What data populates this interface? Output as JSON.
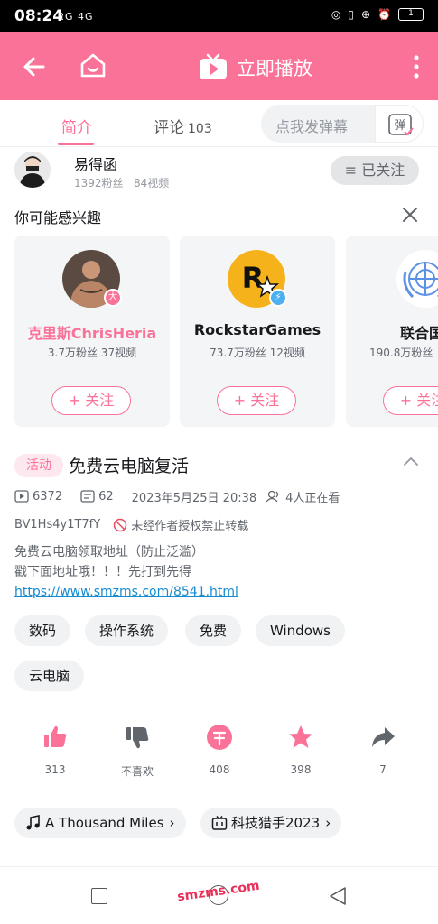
{
  "status_bar": {
    "time": "08:24",
    "signal": "2G 4G",
    "battery": "1"
  },
  "header": {
    "title": "立即播放",
    "accent": "#fb7299"
  },
  "tabs": {
    "intro": "简介",
    "comment": "评论",
    "comment_count": "103",
    "danmaku_placeholder": "点我发弹幕",
    "danmaku_button": "弹"
  },
  "uploader": {
    "name": "易得函",
    "fans": "1392粉丝",
    "videos": "84视频",
    "follow_state": "≡ 已关注"
  },
  "recommend": {
    "title": "你可能感兴趣",
    "cards": [
      {
        "name": "克里斯ChrisHeria",
        "stats": "3.7万粉丝 37视频",
        "follow": "+ 关注",
        "name_color": "#fb7299",
        "badge": "大"
      },
      {
        "name": "RockstarGames",
        "stats": "73.7万粉丝 12视频",
        "follow": "+ 关注",
        "name_color": "#18191c",
        "badge": "⚡"
      },
      {
        "name": "联合国",
        "stats": "190.8万粉丝",
        "follow": "+ 关注",
        "name_color": "#18191c"
      }
    ]
  },
  "video": {
    "tag": "活动",
    "title": "免费云电脑复活",
    "plays": "6372",
    "danmaku": "62",
    "date": "2023年5月25日 20:38",
    "watching": "4人正在看",
    "bvid": "BV1Hs4y1T7fY",
    "reprint_notice": "未经作者授权禁止转载",
    "desc_line1": "免费云电脑领取地址（防止泛滥）",
    "desc_line2": "戳下面地址哦！！！先打到先得",
    "link": "https://www.smzms.com/8541.html"
  },
  "tags": [
    "数码",
    "操作系统",
    "免费",
    "Windows",
    "云电脑"
  ],
  "actions": {
    "like": "313",
    "dislike": "不喜欢",
    "coin": "408",
    "favorite": "398",
    "share": "7"
  },
  "bottom_pills": {
    "music": "A Thousand Miles",
    "event": "科技猎手2023"
  },
  "watermark": "smzms.com"
}
